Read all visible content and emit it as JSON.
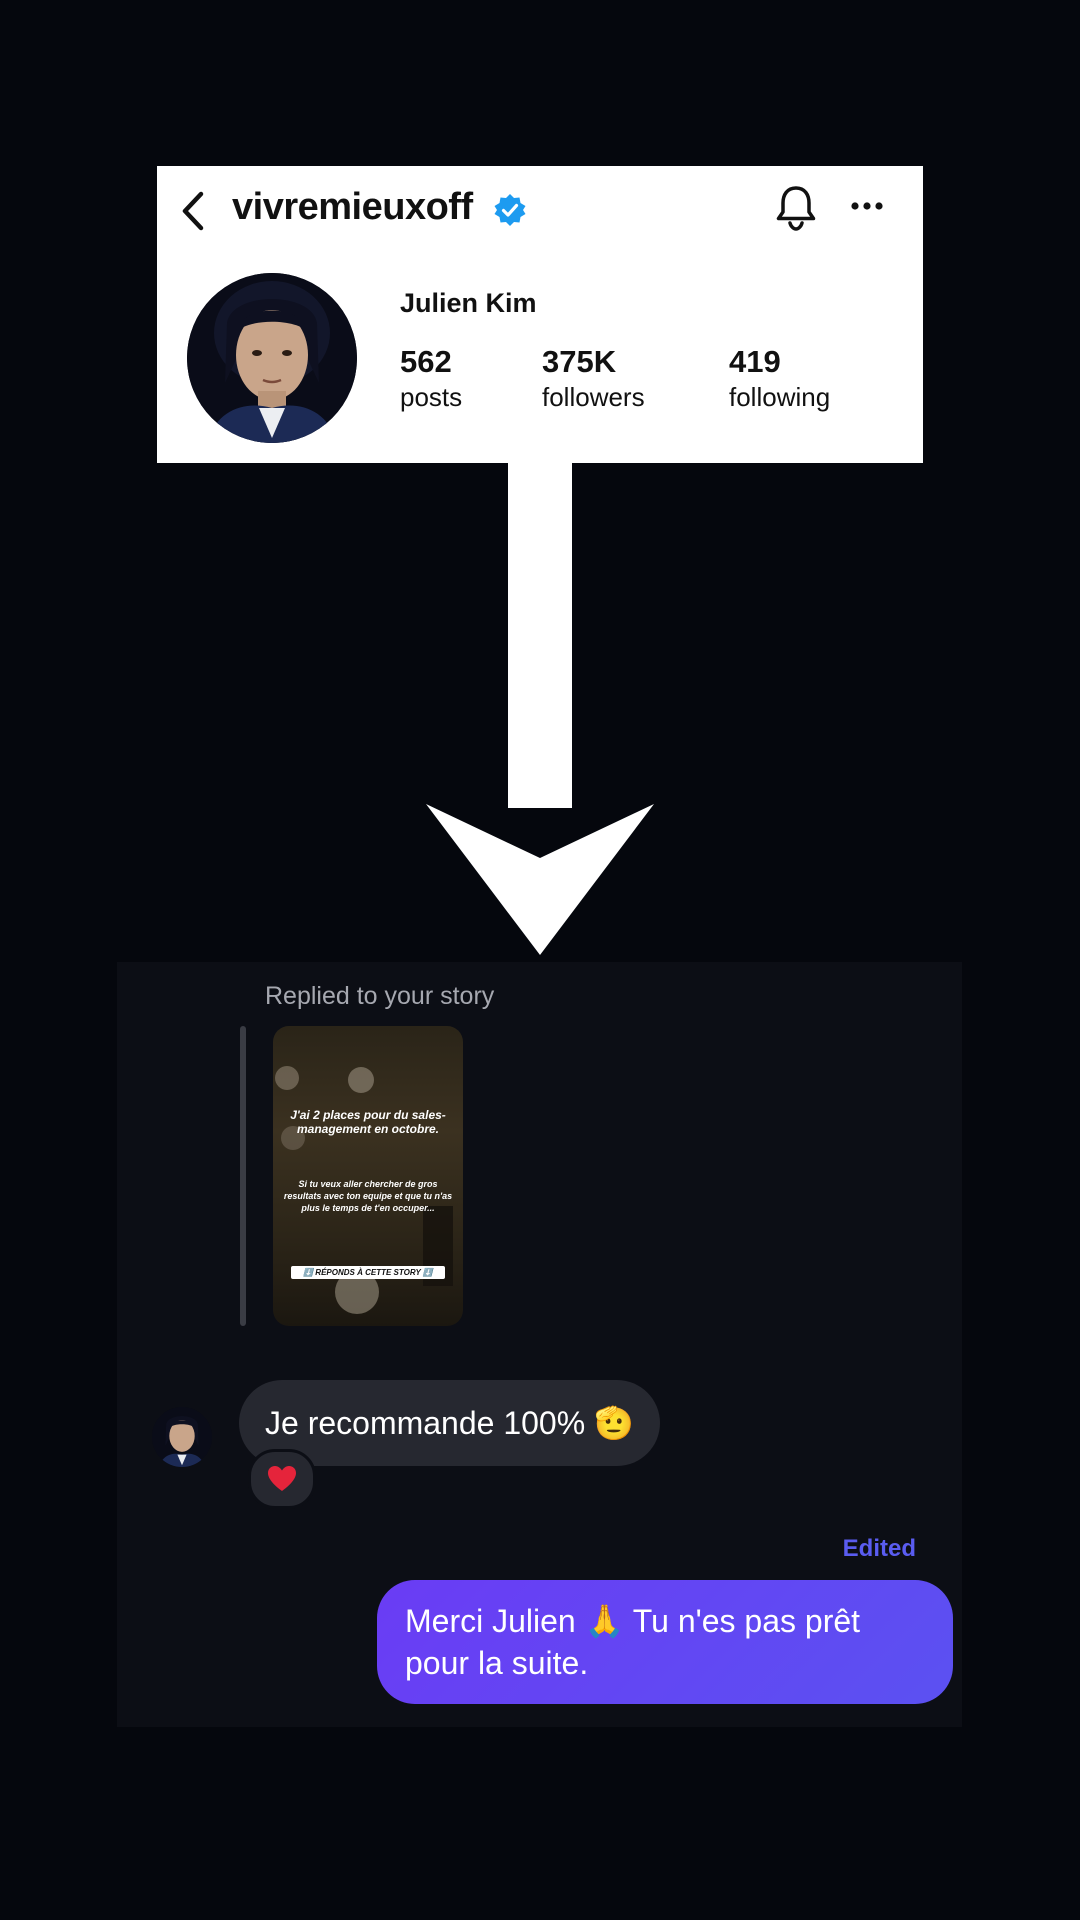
{
  "profile": {
    "username": "vivremieuxoff",
    "display_name": "Julien Kim",
    "stats": [
      {
        "value": "562",
        "label": "posts"
      },
      {
        "value": "375K",
        "label": "followers"
      },
      {
        "value": "419",
        "label": "following"
      }
    ],
    "icons": [
      "chevron-left-icon",
      "verified-badge-icon",
      "bell-icon",
      "more-horizontal-icon"
    ],
    "verified_color": "#1d9bf0"
  },
  "chat": {
    "replied_label": "Replied to your story",
    "story": {
      "headline": "J'ai 2 places pour du sales-management en octobre.",
      "body": "Si tu veux aller chercher de gros resultats avec ton equipe et que tu n'as plus le temps de t'en occuper...",
      "cta": "⬇️ RÉPONDS À CETTE STORY ⬇️"
    },
    "incoming_message": "Je recommande 100% 🫡",
    "reaction": "❤️",
    "edited_label": "Edited",
    "outgoing_message": "Merci Julien 🙏 Tu n'es pas prêt pour la suite.",
    "outgoing_color": "#5b51f2"
  }
}
